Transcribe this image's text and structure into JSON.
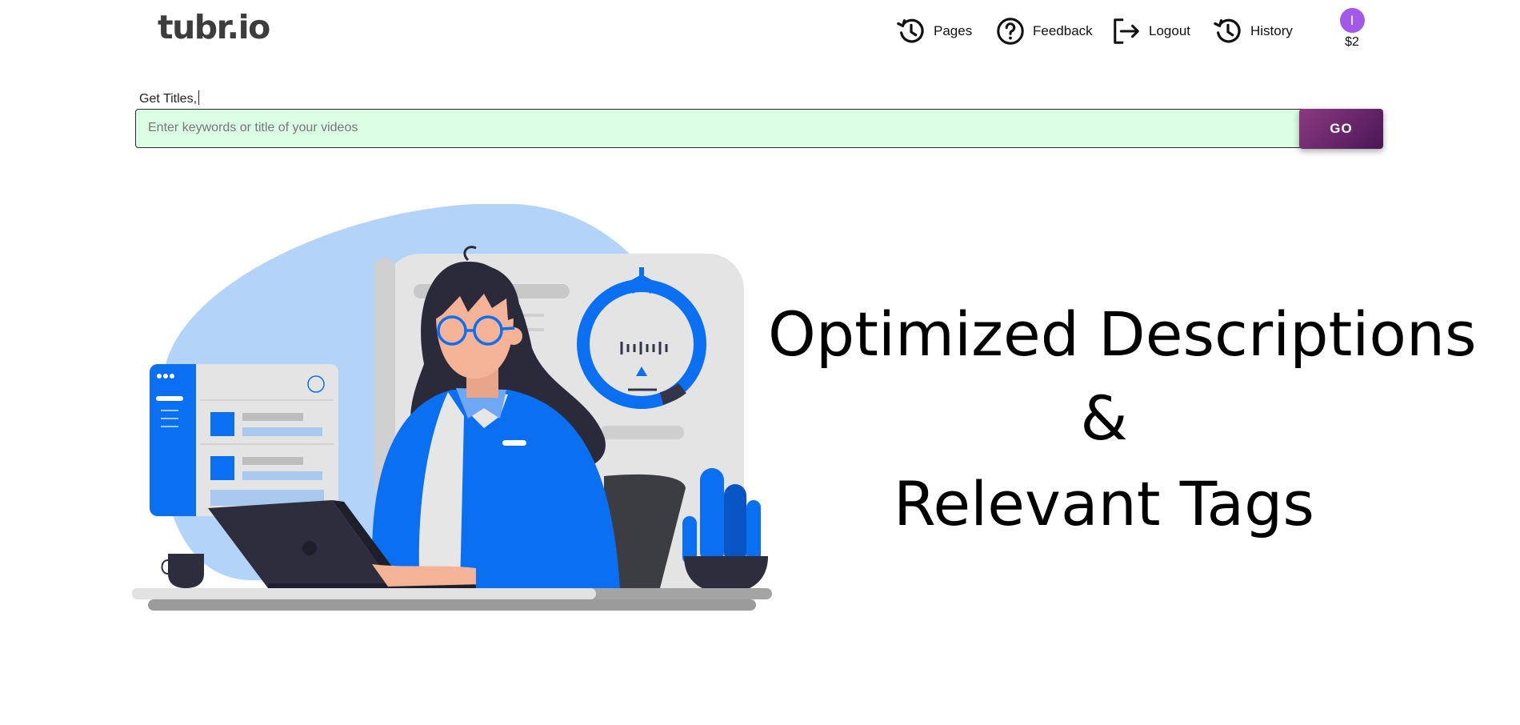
{
  "brand": {
    "logo": "tubr.io"
  },
  "nav": {
    "items": [
      {
        "label": "Pages",
        "icon": "history-icon"
      },
      {
        "label": "Feedback",
        "icon": "question-circle-icon"
      },
      {
        "label": "Logout",
        "icon": "logout-icon"
      },
      {
        "label": "History",
        "icon": "history-icon"
      }
    ]
  },
  "user": {
    "avatar_initial": "I",
    "balance": "$2",
    "avatar_color": "#a259e8"
  },
  "search": {
    "label": "Get Titles,",
    "placeholder": "Enter keywords or title of your videos",
    "value": "",
    "button_label": "GO",
    "field_color": "#dafde3"
  },
  "hero": {
    "line1": "Optimized Descriptions",
    "line2": "&",
    "line3": "Relevant Tags"
  },
  "colors": {
    "accent_blue": "#0a6ff0",
    "button_gradient_start": "#8b3a7f",
    "button_gradient_end": "#4a1656"
  }
}
